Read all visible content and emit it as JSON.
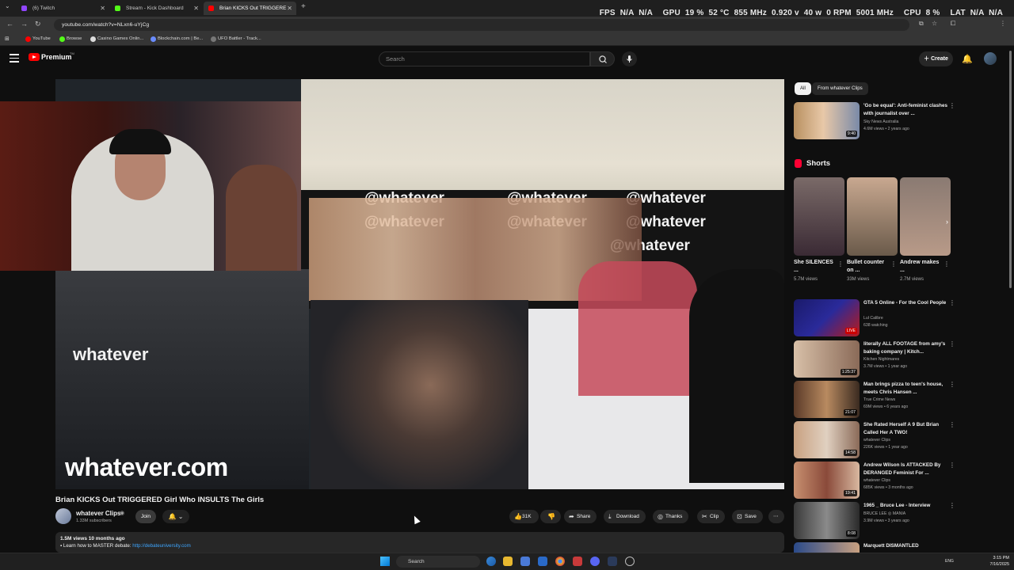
{
  "browser": {
    "tabs": [
      {
        "title": "(6) Twitch",
        "color": "#9146ff"
      },
      {
        "title": "Stream - Kick Dashboard",
        "color": "#53fc18"
      },
      {
        "title": "Brian KICKS Out TRIGGERE",
        "color": "#ff0000"
      }
    ],
    "new_tab": "+",
    "url": "youtube.com/watch?v=NLxn6-uYjCg",
    "bookmarks": [
      {
        "label": "YouTube",
        "color": "#ff0000"
      },
      {
        "label": "Browse",
        "color": "#53fc18"
      },
      {
        "label": "Casino Games Onlin...",
        "color": "#dddddd"
      },
      {
        "label": "Blockchain.com | Be...",
        "color": "#6a8cff"
      },
      {
        "label": "UFO Battler - Track...",
        "color": "#777777"
      }
    ]
  },
  "overlay": {
    "fps_label": "FPS",
    "fps_val1": "N/A",
    "fps_val2": "N/A",
    "gpu_label": "GPU",
    "gpu_util": "19 %",
    "gpu_temp": "52 °C",
    "gpu_clock": "855 MHz",
    "gpu_volt": "0.920 v",
    "gpu_power": "40 w",
    "gpu_rpm": "0 RPM",
    "gpu_mem": "5001 MHz",
    "cpu_label": "CPU",
    "cpu_util": "8 %",
    "lat_label": "LAT",
    "lat_val1": "N/A",
    "lat_val2": "N/A"
  },
  "youtube": {
    "brand": "Premium",
    "brand_sup": "TM",
    "search_placeholder": "Search",
    "create_label": "Create"
  },
  "video": {
    "watermarks": [
      "@whatever",
      "whatever"
    ],
    "big_watermark": "whatever.com",
    "title": "Brian KICKS Out TRIGGERED Girl Who INSULTS The Girls",
    "channel": "whatever Clips",
    "subscribers": "1.33M subscribers",
    "join_label": "Join",
    "likes": "31K",
    "share_label": "Share",
    "download_label": "Download",
    "thanks_label": "Thanks",
    "clip_label": "Clip",
    "save_label": "Save",
    "views_line": "1.5M views  10 months ago",
    "desc_prefix": "Learn how to MASTER debate: ",
    "desc_link": "http://debateuniversity.com"
  },
  "sidebar": {
    "chips": [
      "All",
      "From whatever Clips"
    ],
    "top_rec": {
      "title": "'Go be equal': Anti-feminist clashes with journalist over ...",
      "channel": "Sky News Australia",
      "meta": "4.6M views • 2 years ago",
      "duration": "9:40"
    },
    "shorts_title": "Shorts",
    "shorts": [
      {
        "title": "She SILENCES ...",
        "views": "5.7M views"
      },
      {
        "title": "Bullet counter on ...",
        "views": "33M views"
      },
      {
        "title": "Andrew makes ...",
        "views": "2.7M views"
      }
    ],
    "recs": [
      {
        "title": "GTA 5 Online - For the Cool People",
        "channel": "Lul Calibre",
        "meta": "638 watching",
        "duration": "LIVE"
      },
      {
        "title": "literally ALL FOOTAGE from amy's baking company | Kitch...",
        "channel": "Kitchen Nightmares",
        "meta": "3.7M views • 1 year ago",
        "duration": "1:25:37"
      },
      {
        "title": "Man brings pizza to teen's house, meets Chris Hansen ...",
        "channel": "True Crime News",
        "meta": "69M views • 6 years ago",
        "duration": "21:07"
      },
      {
        "title": "She Rated Herself A 9 But Brian Called Her A TWO!",
        "channel": "whatever Clips",
        "meta": "226K views • 1 year ago",
        "duration": "14:58"
      },
      {
        "title": "Andrew Wilson Is ATTACKED By DERANGED Feminist For ...",
        "channel": "whatever Clips",
        "meta": "685K views • 3 months ago",
        "duration": "19:41"
      },
      {
        "title": "1965 _ Bruce Lee - Interview",
        "channel": "BRUCE LEE ◎ MANIA",
        "meta": "3.9M views • 3 years ago",
        "duration": "8:08"
      },
      {
        "title": "Marquett DISMANTLED",
        "channel": "",
        "meta": "",
        "duration": ""
      }
    ]
  },
  "taskbar": {
    "search_placeholder": "Search",
    "lang": "ENG",
    "time": "3:15 PM",
    "date": "7/16/2025"
  }
}
